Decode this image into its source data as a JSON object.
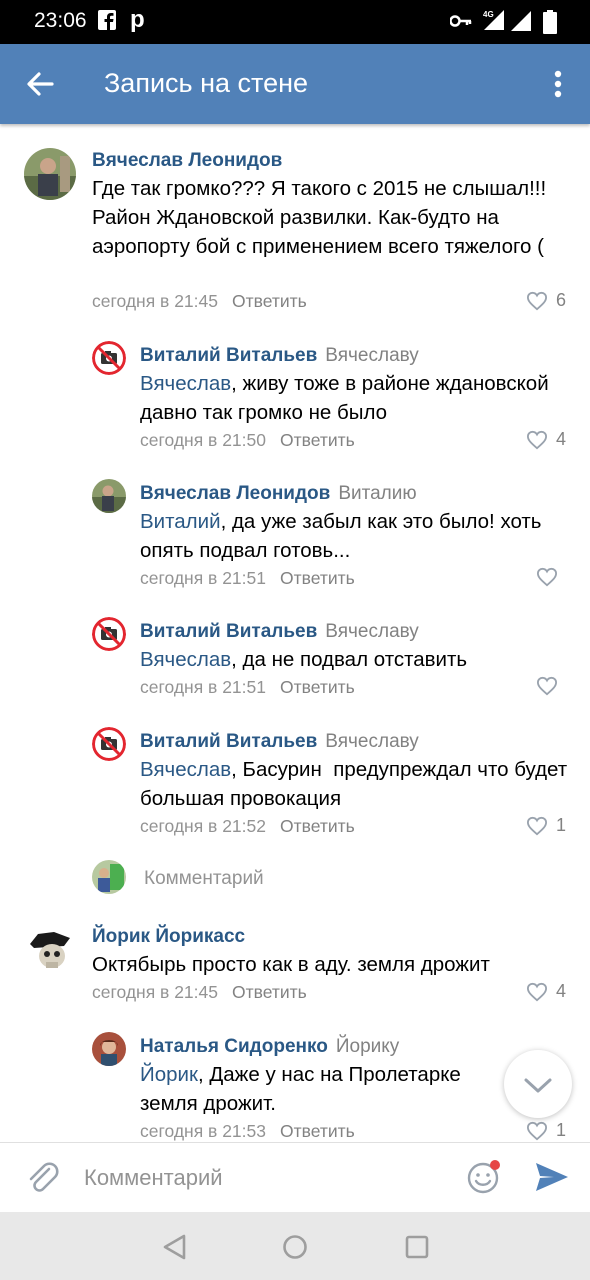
{
  "status_bar": {
    "time": "23:06",
    "icons": [
      "facebook-icon",
      "p-icon",
      "key-icon",
      "signal-4g-icon",
      "signal-icon",
      "battery-icon"
    ],
    "network": "4G"
  },
  "app_bar": {
    "title": "Запись на стене"
  },
  "comments": [
    {
      "author": "Вячеслав Леонидов",
      "reply_to": "",
      "mention": "",
      "text": "Где так громко??? Я такого с 2015 не слышал!!! Район Ждановской развилки. Как-будто на аэропорту бой с применением всего тяжелого (",
      "time": "сегодня в 21:45",
      "reply_label": "Ответить",
      "likes": "6"
    },
    {
      "author": "Виталий Витальев",
      "reply_to": "Вячеславу",
      "mention": "Вячеслав",
      "text": ", живу тоже в районе ждановской давно так громко не было",
      "time": "сегодня в 21:50",
      "reply_label": "Ответить",
      "likes": "4"
    },
    {
      "author": "Вячеслав Леонидов",
      "reply_to": "Виталию",
      "mention": "Виталий",
      "text": ", да уже забыл как это было! хоть опять подвал готовь...",
      "time": "сегодня в 21:51",
      "reply_label": "Ответить",
      "likes": ""
    },
    {
      "author": "Виталий Витальев",
      "reply_to": "Вячеславу",
      "mention": "Вячеслав",
      "text": ", да не подвал отставить",
      "time": "сегодня в 21:51",
      "reply_label": "Ответить",
      "likes": ""
    },
    {
      "author": "Виталий Витальев",
      "reply_to": "Вячеславу",
      "mention": "Вячеслав",
      "text": ", Басурин  предупреждал что будет большая провокация",
      "time": "сегодня в 21:52",
      "reply_label": "Ответить",
      "likes": "1"
    },
    {
      "author": "Йорик Йорикасс",
      "reply_to": "",
      "mention": "",
      "text": "Октябырь просто как в аду. земля дрожит",
      "time": "сегодня в 21:45",
      "reply_label": "Ответить",
      "likes": "4"
    },
    {
      "author": "Наталья Сидоренко",
      "reply_to": "Йорику",
      "mention": "Йорик",
      "text": ", Даже у нас на Пролетарке земля дрожит.",
      "time": "сегодня в 21:53",
      "reply_label": "Ответить",
      "likes": "1"
    }
  ],
  "thread_comment_placeholder": "Комментарий",
  "input": {
    "placeholder": "Комментарий"
  },
  "colors": {
    "app_bar": "#5181b8",
    "link": "#2a5885",
    "meta": "#939393",
    "send": "#5181b8",
    "notification_dot": "#e64646"
  }
}
